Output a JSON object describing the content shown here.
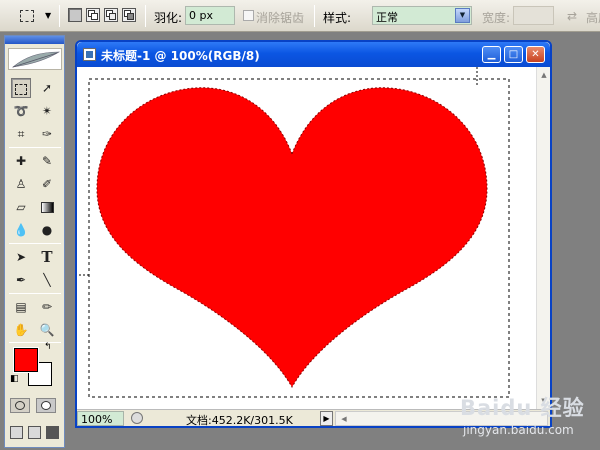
{
  "options_bar": {
    "feather_label": "羽化:",
    "feather_value": "0 px",
    "antialias_label": "消除锯齿",
    "style_label": "样式:",
    "style_value": "正常",
    "width_label": "宽度:",
    "width_value": "",
    "height_label": "高度"
  },
  "toolbox": {
    "foreground_color": "#ff0000",
    "background_color": "#ffffff",
    "tools": [
      "rect-marquee",
      "move",
      "lasso",
      "magic-wand",
      "crop",
      "slice",
      "healing-brush",
      "brush",
      "clone-stamp",
      "history-brush",
      "eraser",
      "gradient",
      "blur",
      "dodge",
      "path-select",
      "type",
      "pen",
      "line",
      "notes",
      "eyedropper",
      "hand",
      "zoom"
    ],
    "type_tool_glyph": "T"
  },
  "document": {
    "title": "未标题-1 @ 100%(RGB/8)",
    "shape_color": "#ff0000",
    "zoom": "100%",
    "doc_info": "文档:452.2K/301.5K"
  },
  "watermark": {
    "logo": "Baidu 经验",
    "url": "jingyan.baidu.com"
  }
}
